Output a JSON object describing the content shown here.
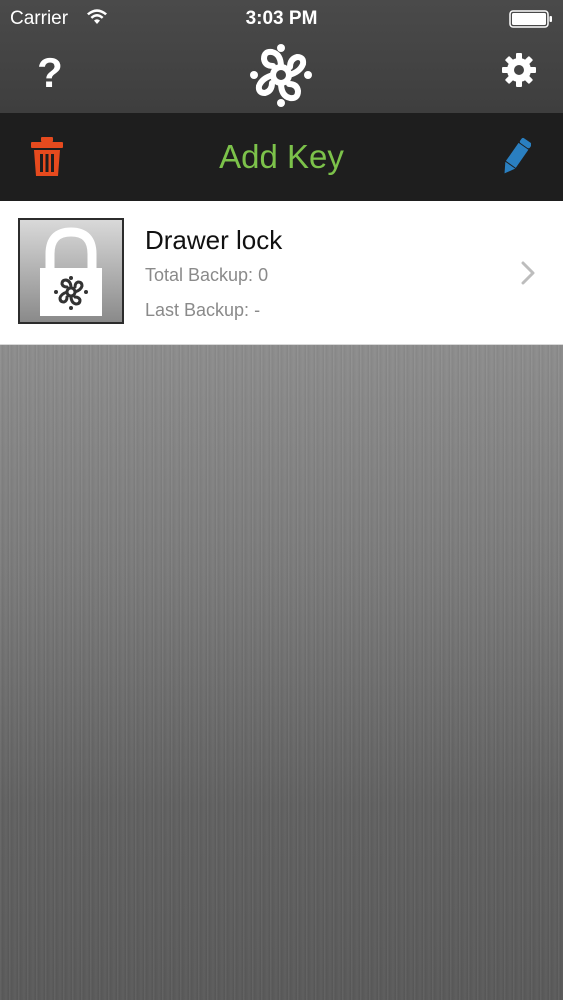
{
  "status_bar": {
    "carrier": "Carrier",
    "time": "3:03 PM"
  },
  "nav_bar": {
    "help_label": "?",
    "logo_icon": "chain-link-logo-icon",
    "settings_icon": "gear-icon"
  },
  "toolbar": {
    "delete_icon": "trash-icon",
    "add_key_label": "Add Key",
    "edit_icon": "pencil-icon",
    "colors": {
      "add_key": "#7cc24a",
      "trash": "#e64a1e",
      "pencil": "#2a7fc0"
    }
  },
  "keys": [
    {
      "name": "Drawer lock",
      "total_backup": "Total Backup: 0",
      "last_backup": "Last Backup: -",
      "icon": "padlock-icon"
    }
  ]
}
